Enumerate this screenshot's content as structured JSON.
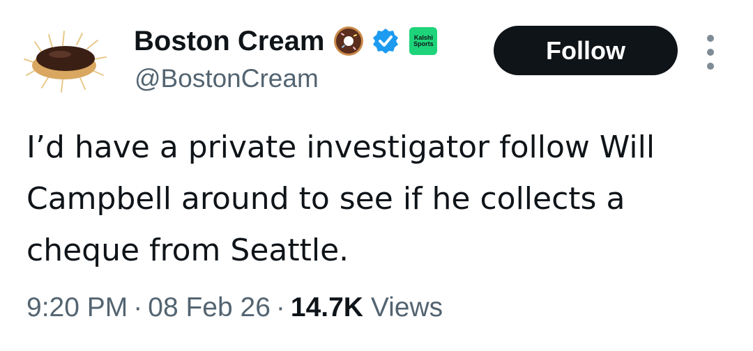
{
  "tweet": {
    "author": {
      "display_name": "Boston Cream",
      "handle": "@BostonCream",
      "avatar_icon": "boston-cream-donut-avatar",
      "name_emoji_icon": "donut-emoji-icon",
      "verified_icon": "verified-badge-icon",
      "affiliate_badge": {
        "line1": "Kalshi",
        "line2": "Sports",
        "color": "#1ed47a"
      }
    },
    "follow_label": "Follow",
    "text": "I’d have a private investigator follow Will Campbell around to see if he collects a cheque from Seattle.",
    "meta": {
      "time": "9:20 PM",
      "date": "08 Feb 26",
      "separator": "·",
      "views_count": "14.7K",
      "views_label": "Views"
    }
  },
  "colors": {
    "text_primary": "#0f1419",
    "text_secondary": "#536471",
    "verified_blue": "#1d9bf0",
    "button_bg": "#0f1419"
  }
}
